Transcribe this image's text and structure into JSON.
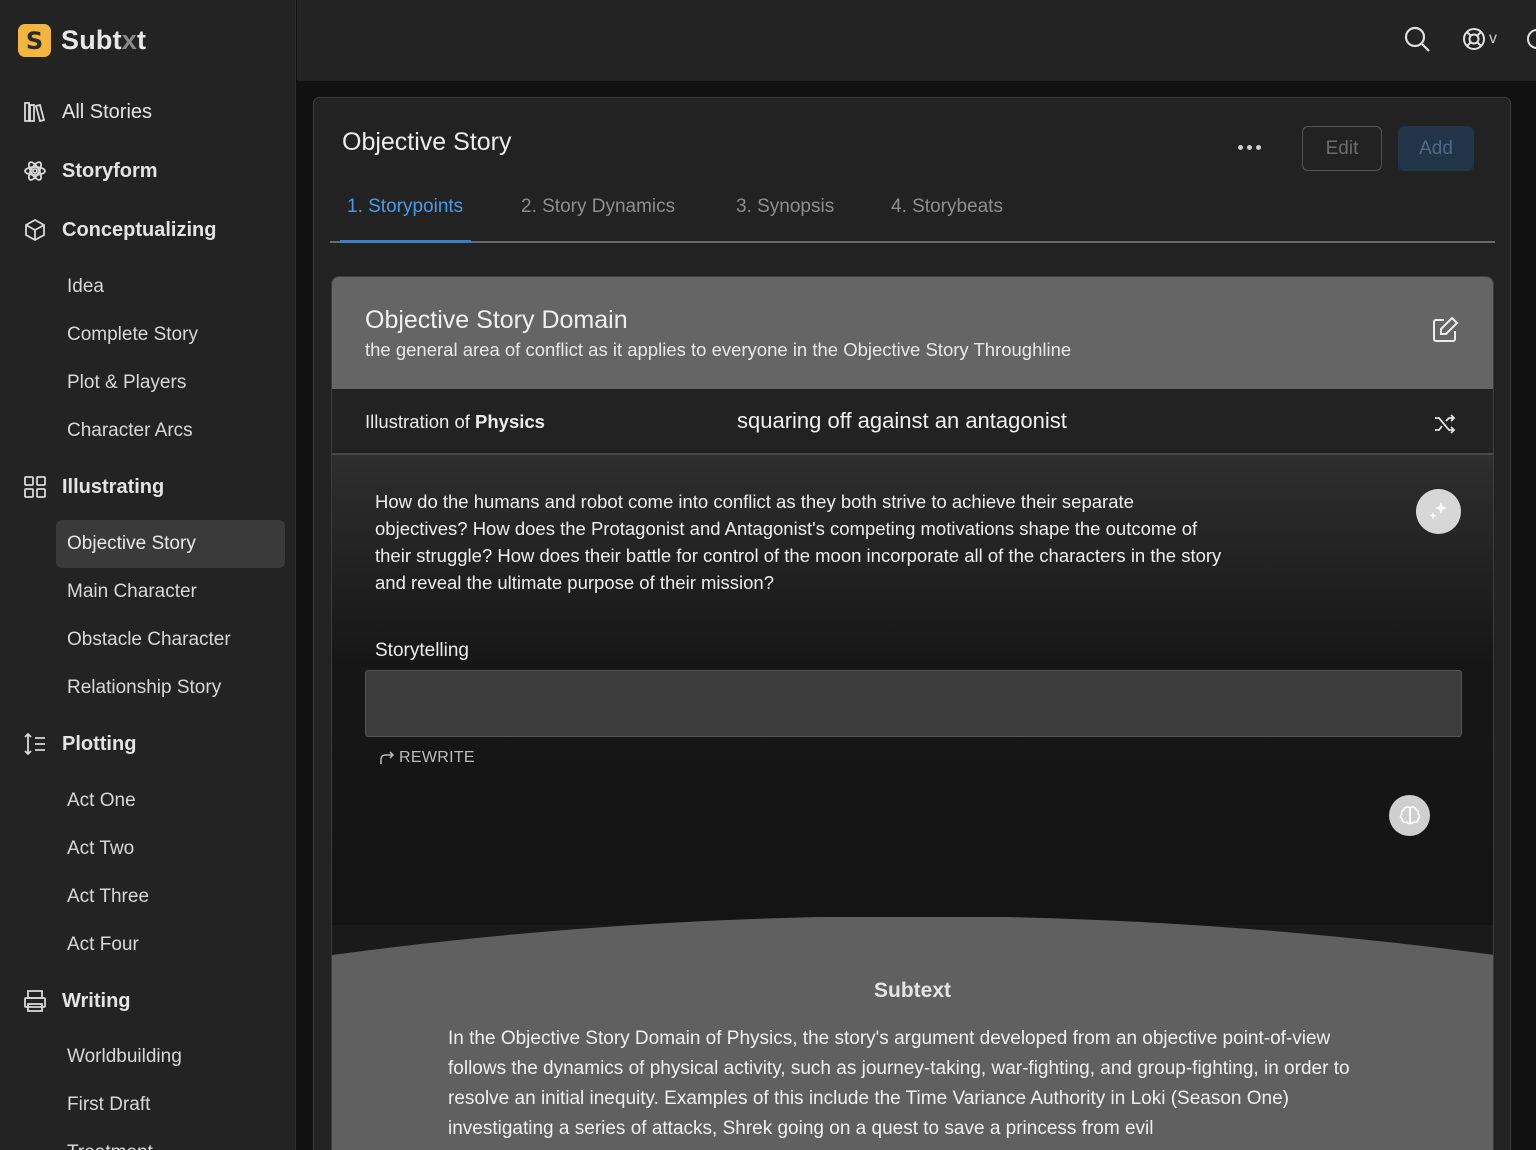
{
  "brand": {
    "logo_letter": "S",
    "name_main": "Subt",
    "name_dim": "x",
    "name_tail": "t"
  },
  "sidebar": {
    "sections": [
      {
        "label": "All Stories",
        "icon": "books-icon"
      },
      {
        "label": "Storyform",
        "icon": "atom-icon"
      },
      {
        "label": "Conceptualizing",
        "icon": "cube-icon"
      },
      {
        "label": "Illustrating",
        "icon": "grid-icon"
      },
      {
        "label": "Plotting",
        "icon": "sort-list-icon"
      },
      {
        "label": "Writing",
        "icon": "printer-icon"
      }
    ],
    "conceptualizing_items": [
      "Idea",
      "Complete Story",
      "Plot & Players",
      "Character Arcs"
    ],
    "illustrating_items": [
      "Objective Story",
      "Main Character",
      "Obstacle Character",
      "Relationship Story"
    ],
    "plotting_items": [
      "Act One",
      "Act Two",
      "Act Three",
      "Act Four"
    ],
    "writing_items": [
      "Worldbuilding",
      "First Draft",
      "Treatment"
    ],
    "active_item": "Objective Story"
  },
  "topbar": {
    "icons": [
      "search-icon",
      "help-lifebuoy-icon",
      "chevron-down-icon",
      "globe-icon"
    ],
    "help_chevron": "v"
  },
  "panel": {
    "title": "Objective Story",
    "edit_label": "Edit",
    "add_label": "Add",
    "tabs": [
      "1. Storypoints",
      "2. Story Dynamics",
      "3. Synopsis",
      "4. Storybeats"
    ],
    "active_tab": 0
  },
  "card": {
    "title": "Objective Story Domain",
    "subtitle": "the general area of conflict as it applies to everyone in the Objective Story Throughline",
    "illustration_prefix": "Illustration of ",
    "illustration_term": "Physics",
    "illustration_value": "squaring off against an antagonist",
    "question": "How do the humans and robot come into conflict as they both strive to achieve their separate objectives? How does the Protagonist and Antagonist's competing motivations shape the outcome of their struggle? How does their battle for control of the moon incorporate all of the characters in the story and reveal the ultimate purpose of their mission?",
    "storytelling_label": "Storytelling",
    "storytelling_value": "",
    "rewrite_label": "REWRITE",
    "subtext_title": "Subtext",
    "subtext_body": "In the Objective Story Domain of Physics, the story's argument developed from an objective point-of-view follows the dynamics of physical activity, such as journey-taking, war-fighting, and group-fighting, in order to resolve an initial inequity. Examples of this include the Time Variance Authority in Loki (Season One) investigating a series of attacks, Shrek going on a quest to save a princess from evil"
  },
  "colors": {
    "accent": "#4a9be6",
    "brand": "#f2b53d",
    "sidebar_bg": "#232323",
    "active_item_bg": "#3a3a3a",
    "header_bg": "#656565"
  }
}
